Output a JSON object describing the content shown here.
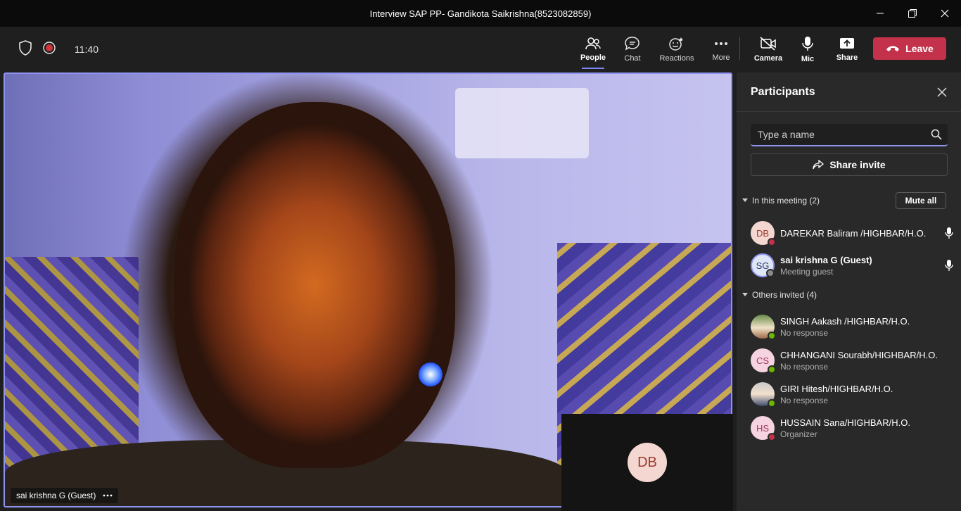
{
  "window": {
    "title": "Interview SAP PP- Gandikota Saikrishna(8523082859)"
  },
  "toolbar": {
    "timer": "11:40",
    "people_label": "People",
    "chat_label": "Chat",
    "reactions_label": "Reactions",
    "more_label": "More",
    "camera_label": "Camera",
    "mic_label": "Mic",
    "share_label": "Share",
    "leave_label": "Leave"
  },
  "video": {
    "participant_name": "sai krishna G (Guest)",
    "self_tile_initials": "DB"
  },
  "participants_panel": {
    "title": "Participants",
    "search_placeholder": "Type a name",
    "share_invite_label": "Share invite",
    "in_meeting_label": "In this meeting (2)",
    "mute_all_label": "Mute all",
    "in_meeting": [
      {
        "initials": "DB",
        "name": "DAREKAR Baliram /HIGHBAR/H.O.",
        "sub": "",
        "status": "busy"
      },
      {
        "initials": "SG",
        "name": "sai krishna G (Guest)",
        "sub": "Meeting guest",
        "status": "offline"
      }
    ],
    "others_label": "Others invited (4)",
    "others": [
      {
        "initials": "",
        "name": "SINGH Aakash /HIGHBAR/H.O.",
        "sub": "No response",
        "status": "available"
      },
      {
        "initials": "CS",
        "name": "CHHANGANI Sourabh/HIGHBAR/H.O.",
        "sub": "No response",
        "status": "available"
      },
      {
        "initials": "",
        "name": "GIRI Hitesh/HIGHBAR/H.O.",
        "sub": "No response",
        "status": "available"
      },
      {
        "initials": "HS",
        "name": "HUSSAIN Sana/HIGHBAR/H.O.",
        "sub": "Organizer",
        "status": "busy"
      }
    ]
  },
  "colors": {
    "accent": "#7f85f5",
    "leave": "#c4314b",
    "available": "#6bb700",
    "busy": "#c4314b"
  }
}
